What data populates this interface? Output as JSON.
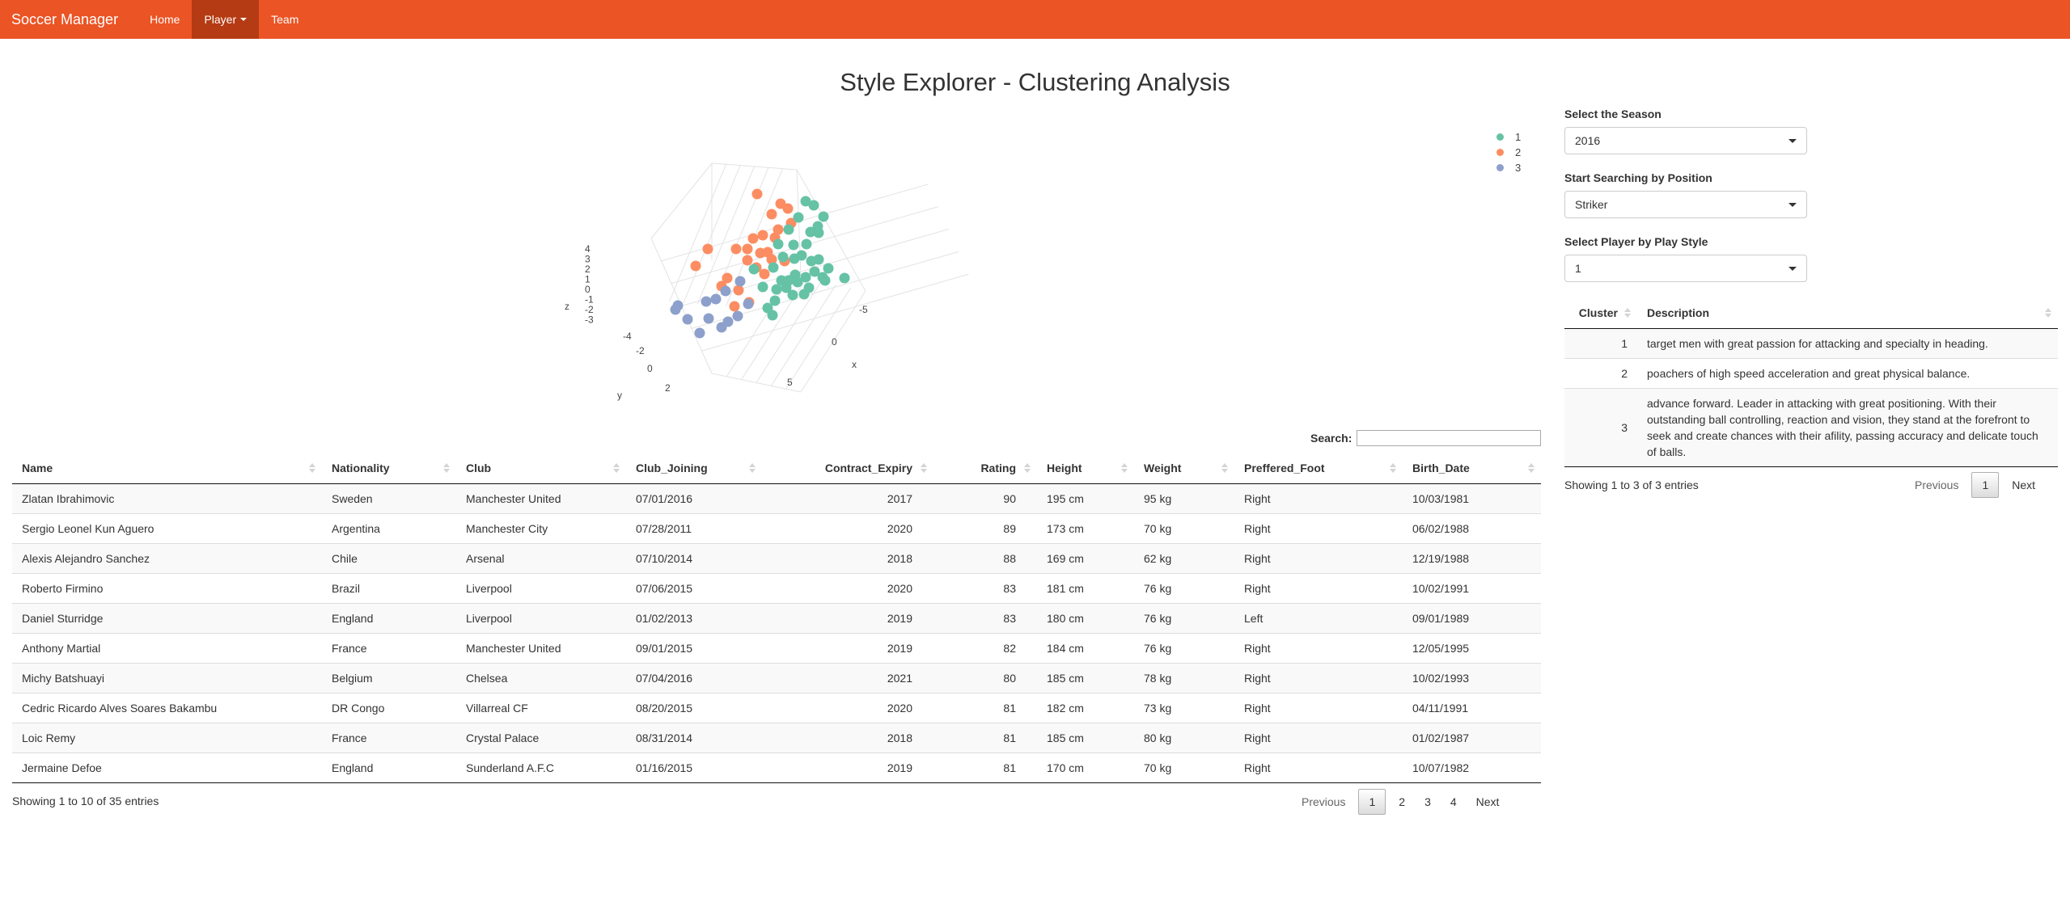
{
  "navbar": {
    "brand": "Soccer Manager",
    "items": [
      {
        "label": "Home",
        "active": false
      },
      {
        "label": "Player",
        "active": true,
        "dropdown": true
      },
      {
        "label": "Team",
        "active": false
      }
    ],
    "color": "#eb5424"
  },
  "page_title": "Style Explorer - Clustering Analysis",
  "chart_data": {
    "type": "scatter",
    "mode": "3d",
    "axes": {
      "x": "x",
      "y": "y",
      "z": "z"
    },
    "x_ticks": [
      "-5",
      "0",
      "5"
    ],
    "y_ticks": [
      "-4",
      "-2",
      "0",
      "2"
    ],
    "z_ticks": [
      "4",
      "3",
      "2",
      "1",
      "0",
      "-1",
      "-2",
      "-3"
    ],
    "legend_position": "top-right",
    "series": [
      {
        "name": "1",
        "color": "#66c2a5"
      },
      {
        "name": "2",
        "color": "#fc8d62"
      },
      {
        "name": "3",
        "color": "#8da0cb"
      }
    ]
  },
  "controls": {
    "season": {
      "label": "Select the Season",
      "value": "2016"
    },
    "position": {
      "label": "Start Searching by Position",
      "value": "Striker"
    },
    "style": {
      "label": "Select Player by Play Style",
      "value": "1"
    }
  },
  "clusters": {
    "headers": [
      "Cluster",
      "Description"
    ],
    "rows": [
      {
        "cluster": "1",
        "description": "target men with great passion for attacking and specialty in heading."
      },
      {
        "cluster": "2",
        "description": "poachers of high speed acceleration and great physical balance."
      },
      {
        "cluster": "3",
        "description": "advance forward. Leader in attacking with great positioning. With their outstanding ball controlling, reaction and vision, they stand at the forefront to seek and create chances with their afility, passing accuracy and delicate touch of balls."
      }
    ],
    "info": "Showing 1 to 3 of 3 entries",
    "pager": {
      "previous": "Previous",
      "pages": [
        "1"
      ],
      "next": "Next"
    }
  },
  "players": {
    "search_label": "Search:",
    "headers": [
      "Name",
      "Nationality",
      "Club",
      "Club_Joining",
      "Contract_Expiry",
      "Rating",
      "Height",
      "Weight",
      "Preffered_Foot",
      "Birth_Date"
    ],
    "rows": [
      [
        "Zlatan Ibrahimovic",
        "Sweden",
        "Manchester United",
        "07/01/2016",
        "2017",
        "90",
        "195 cm",
        "95 kg",
        "Right",
        "10/03/1981"
      ],
      [
        "Sergio Leonel Kun Aguero",
        "Argentina",
        "Manchester City",
        "07/28/2011",
        "2020",
        "89",
        "173 cm",
        "70 kg",
        "Right",
        "06/02/1988"
      ],
      [
        "Alexis Alejandro Sanchez",
        "Chile",
        "Arsenal",
        "07/10/2014",
        "2018",
        "88",
        "169 cm",
        "62 kg",
        "Right",
        "12/19/1988"
      ],
      [
        "Roberto Firmino",
        "Brazil",
        "Liverpool",
        "07/06/2015",
        "2020",
        "83",
        "181 cm",
        "76 kg",
        "Right",
        "10/02/1991"
      ],
      [
        "Daniel Sturridge",
        "England",
        "Liverpool",
        "01/02/2013",
        "2019",
        "83",
        "180 cm",
        "76 kg",
        "Left",
        "09/01/1989"
      ],
      [
        "Anthony Martial",
        "France",
        "Manchester United",
        "09/01/2015",
        "2019",
        "82",
        "184 cm",
        "76 kg",
        "Right",
        "12/05/1995"
      ],
      [
        "Michy Batshuayi",
        "Belgium",
        "Chelsea",
        "07/04/2016",
        "2021",
        "80",
        "185 cm",
        "78 kg",
        "Right",
        "10/02/1993"
      ],
      [
        "Cedric Ricardo Alves Soares Bakambu",
        "DR Congo",
        "Villarreal CF",
        "08/20/2015",
        "2020",
        "81",
        "182 cm",
        "73 kg",
        "Right",
        "04/11/1991"
      ],
      [
        "Loic Remy",
        "France",
        "Crystal Palace",
        "08/31/2014",
        "2018",
        "81",
        "185 cm",
        "80 kg",
        "Right",
        "01/02/1987"
      ],
      [
        "Jermaine Defoe",
        "England",
        "Sunderland A.F.C",
        "01/16/2015",
        "2019",
        "81",
        "170 cm",
        "70 kg",
        "Right",
        "10/07/1982"
      ]
    ],
    "info": "Showing 1 to 10 of 35 entries",
    "pager": {
      "previous": "Previous",
      "pages": [
        "1",
        "2",
        "3",
        "4"
      ],
      "next": "Next"
    }
  }
}
